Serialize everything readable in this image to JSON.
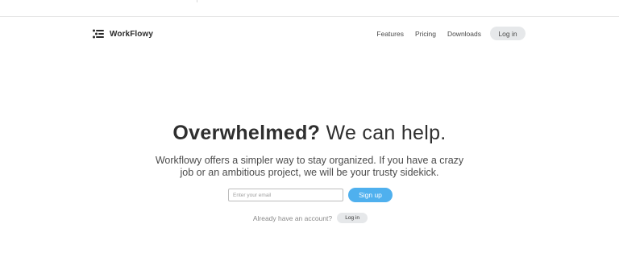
{
  "brand": {
    "name": "WorkFlowy",
    "icon": "workflowy-logo-icon"
  },
  "nav": {
    "links": [
      {
        "label": "Features"
      },
      {
        "label": "Pricing"
      },
      {
        "label": "Downloads"
      }
    ],
    "login_label": "Log in"
  },
  "hero": {
    "headline_bold": "Overwhelmed?",
    "headline_rest": " We can help.",
    "subtext": "Workflowy offers a simpler way to stay organized. If you have a crazy job or an ambitious project, we will be your trusty sidekick."
  },
  "signup": {
    "email_placeholder": "Enter your email",
    "email_value": "",
    "button_label": "Sign up"
  },
  "account": {
    "prompt": "Already have an account?",
    "login_label": "Log in"
  },
  "colors": {
    "accent": "#4fb0ee",
    "pill_bg": "#e6e8ea",
    "text": "#333333"
  }
}
